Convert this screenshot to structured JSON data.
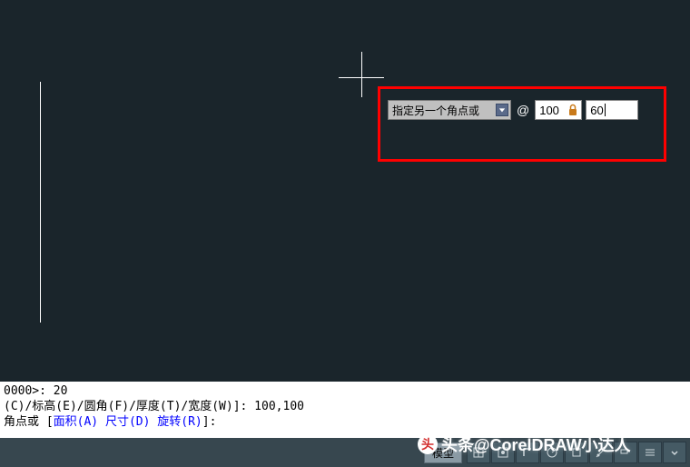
{
  "dynamic_input": {
    "prompt": "指定另一个角点或",
    "at": "@",
    "x_value": "100",
    "y_value": "60"
  },
  "command_lines": {
    "line1": "0000>: 20",
    "line2_prefix": "(C)/标高(E)/圆角(F)/厚度(T)/宽度(W)]: 100,100",
    "line3_prefix": "角点或 [",
    "opt1": "面积(A)",
    "opt2": "尺寸(D)",
    "opt3": "旋转(R)",
    "line3_suffix": "]:"
  },
  "status": {
    "model_tab": "模型"
  },
  "watermark": {
    "text": "头条@CorelDRAW小达人",
    "logo": "头"
  }
}
